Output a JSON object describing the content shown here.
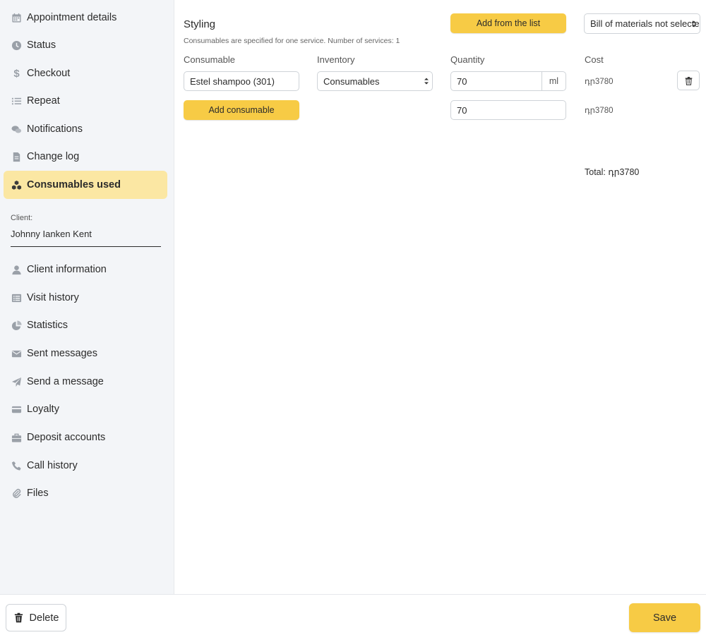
{
  "sidebar": {
    "items_top": [
      {
        "label": "Appointment details",
        "icon": "calendar-icon"
      },
      {
        "label": "Status",
        "icon": "clock-icon"
      },
      {
        "label": "Checkout",
        "icon": "dollar-icon"
      },
      {
        "label": "Repeat",
        "icon": "list-icon"
      },
      {
        "label": "Notifications",
        "icon": "chat-bubbles-icon"
      },
      {
        "label": "Change log",
        "icon": "document-icon"
      },
      {
        "label": "Consumables used",
        "icon": "cubes-icon",
        "active": true
      }
    ],
    "client_label": "Client:",
    "client_name": "Johnny  Ianken Kent",
    "items_bottom": [
      {
        "label": "Client information",
        "icon": "user-icon"
      },
      {
        "label": "Visit history",
        "icon": "list-alt-icon"
      },
      {
        "label": "Statistics",
        "icon": "pie-chart-icon"
      },
      {
        "label": "Sent messages",
        "icon": "envelope-icon"
      },
      {
        "label": "Send a message",
        "icon": "paper-plane-icon"
      },
      {
        "label": "Loyalty",
        "icon": "credit-card-icon"
      },
      {
        "label": "Deposit accounts",
        "icon": "briefcase-icon"
      },
      {
        "label": "Call history",
        "icon": "phone-icon"
      },
      {
        "label": "Files",
        "icon": "paperclip-icon"
      }
    ]
  },
  "main": {
    "title": "Styling",
    "subtitle": "Consumables are specified for one service. Number of services: 1",
    "add_from_list_label": "Add from the list",
    "bom_select_value": "Bill of materials not selected",
    "columns": {
      "consumable": "Consumable",
      "inventory": "Inventory",
      "quantity": "Quantity",
      "cost": "Cost"
    },
    "row": {
      "consumable": "Estel shampoo (301)",
      "inventory": "Consumables",
      "quantity": "70",
      "unit": "ml",
      "cost": "դր3780"
    },
    "add_consumable_label": "Add consumable",
    "second_quantity": "70",
    "second_cost": "դր3780",
    "total": "Total: դր3780"
  },
  "footer": {
    "delete_label": "Delete",
    "save_label": "Save"
  },
  "colors": {
    "accent": "#f7cb45",
    "active_bg": "#fbe7a3",
    "sidebar_bg": "#f3f5f8"
  }
}
